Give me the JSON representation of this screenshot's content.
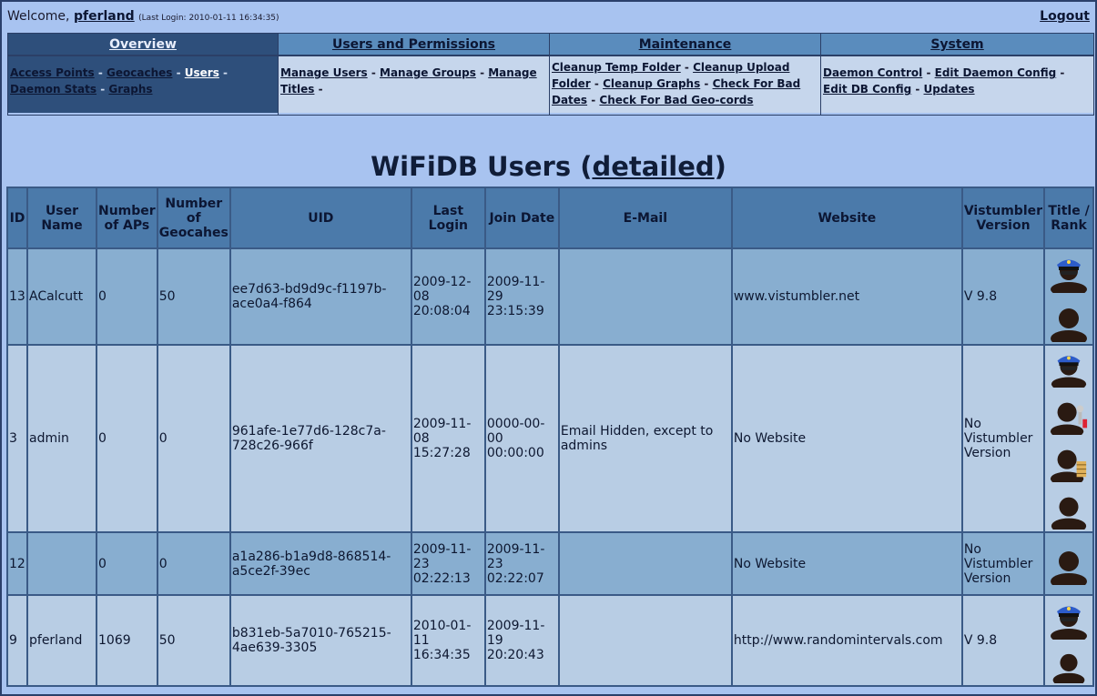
{
  "header": {
    "welcome_prefix": "Welcome,",
    "username": "pferland",
    "last_login": "(Last Login: 2010-01-11 16:34:35)",
    "logout_label": "Logout"
  },
  "nav": {
    "overview": {
      "label": "Overview",
      "links": [
        "Access Points",
        "Geocaches",
        "Users",
        "Daemon Stats",
        "Graphs"
      ]
    },
    "users_permissions": {
      "label": "Users and Permissions",
      "links": [
        "Manage Users",
        "Manage Groups",
        "Manage Titles"
      ]
    },
    "maintenance": {
      "label": "Maintenance",
      "links": [
        "Cleanup Temp Folder",
        "Cleanup Upload Folder",
        "Cleanup Graphs",
        "Check For Bad Dates",
        "Check For Bad Geo-cords"
      ]
    },
    "system": {
      "label": "System",
      "links": [
        "Daemon Control",
        "Edit Daemon Config",
        "Edit DB Config",
        "Updates"
      ]
    }
  },
  "page": {
    "title_prefix": "WiFiDB Users (",
    "title_link": "detailed",
    "title_suffix": ")"
  },
  "table": {
    "columns": [
      "ID",
      "User Name",
      "Number of APs",
      "Number of Geocahes",
      "UID",
      "Last Login",
      "Join Date",
      "E-Mail",
      "Website",
      "Vistumbler Version",
      "Title / Rank"
    ],
    "rows": [
      {
        "id": "13",
        "username": "ACalcutt",
        "aps": "0",
        "geocaches": "50",
        "uid": "ee7d63-bd9d9c-f1197b-ace0a4-f864",
        "last_login": "2009-12-08 20:08:04",
        "join_date": "2009-11-29 23:15:39",
        "email": "",
        "website": "www.vistumbler.net",
        "version": "V 9.8"
      },
      {
        "id": "3",
        "username": "admin",
        "aps": "0",
        "geocaches": "0",
        "uid": "961afe-1e77d6-128c7a-728c26-966f",
        "last_login": "2009-11-08 15:27:28",
        "join_date": "0000-00-00 00:00:00",
        "email": "Email Hidden, except to admins",
        "website": "No Website",
        "version": "No Vistumbler Version"
      },
      {
        "id": "12",
        "username": "",
        "aps": "0",
        "geocaches": "0",
        "uid": "a1a286-b1a9d8-868514-a5ce2f-39ec",
        "last_login": "2009-11-23 02:22:13",
        "join_date": "2009-11-23 02:22:07",
        "email": "",
        "website": "No Website",
        "version": "No Vistumbler Version"
      },
      {
        "id": "9",
        "username": "pferland",
        "aps": "1069",
        "geocaches": "50",
        "uid": "b831eb-5a7010-765215-4ae639-3305",
        "last_login": "2010-01-11 16:34:35",
        "join_date": "2009-11-19 20:20:43",
        "email": "",
        "website": "http://www.randomintervals.com",
        "version": "V 9.8"
      }
    ]
  },
  "icons": {
    "rank_icons": [
      "police-officer-icon",
      "user-silhouette-icon",
      "admin-tools-icon",
      "user-notebook-icon"
    ]
  },
  "colors": {
    "page_bg": "#a8c3f0",
    "nav_active": "#2e4f7b",
    "header_cell": "#4b7aaa",
    "row_odd": "#88aed0",
    "row_even": "#b8cde4"
  }
}
